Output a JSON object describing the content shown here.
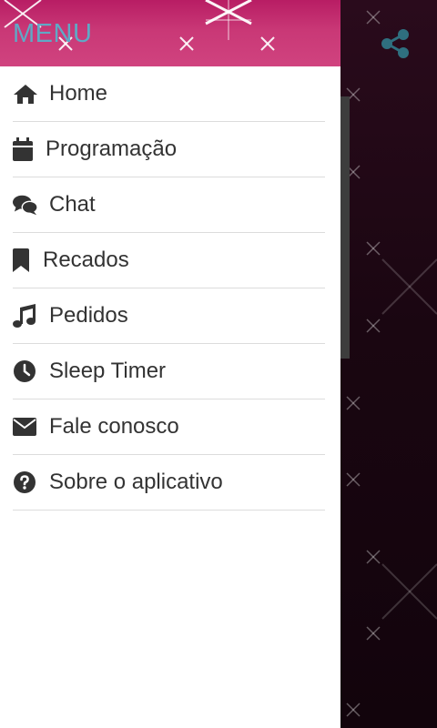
{
  "drawer": {
    "title": "MENU",
    "items": [
      {
        "label": "Home",
        "icon": "home-icon"
      },
      {
        "label": "Programação",
        "icon": "calendar-icon"
      },
      {
        "label": "Chat",
        "icon": "chat-icon"
      },
      {
        "label": "Recados",
        "icon": "bookmark-icon"
      },
      {
        "label": "Pedidos",
        "icon": "music-note-icon"
      },
      {
        "label": "Sleep Timer",
        "icon": "clock-icon"
      },
      {
        "label": "Fale conosco",
        "icon": "envelope-icon"
      },
      {
        "label": "Sobre o aplicativo",
        "icon": "question-circle-icon"
      }
    ]
  },
  "background": {
    "share_icon": "share-icon"
  },
  "colors": {
    "header_pink": "#c93876",
    "title_blue": "#5fa9c6",
    "menu_text": "#333333",
    "background_dark": "#1a0611"
  }
}
